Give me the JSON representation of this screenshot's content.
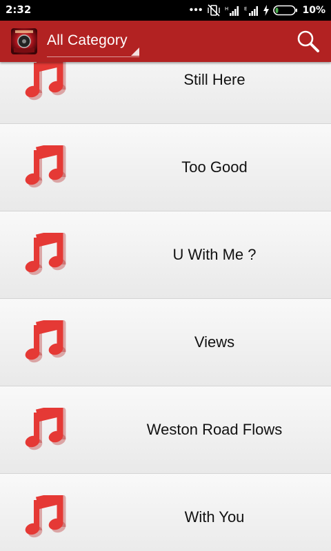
{
  "status_bar": {
    "time": "2:32",
    "dots": "•••",
    "battery_percent": "10%"
  },
  "app_bar": {
    "title": "All Category",
    "logo_icon": "album-logo-icon",
    "search_icon": "search-icon",
    "accent_color": "#b22222"
  },
  "songs": [
    {
      "title": "Still Here"
    },
    {
      "title": "Too Good"
    },
    {
      "title": "U With Me ?"
    },
    {
      "title": "Views"
    },
    {
      "title": "Weston Road Flows"
    },
    {
      "title": "With You"
    }
  ],
  "music_note_color": "#e53935"
}
